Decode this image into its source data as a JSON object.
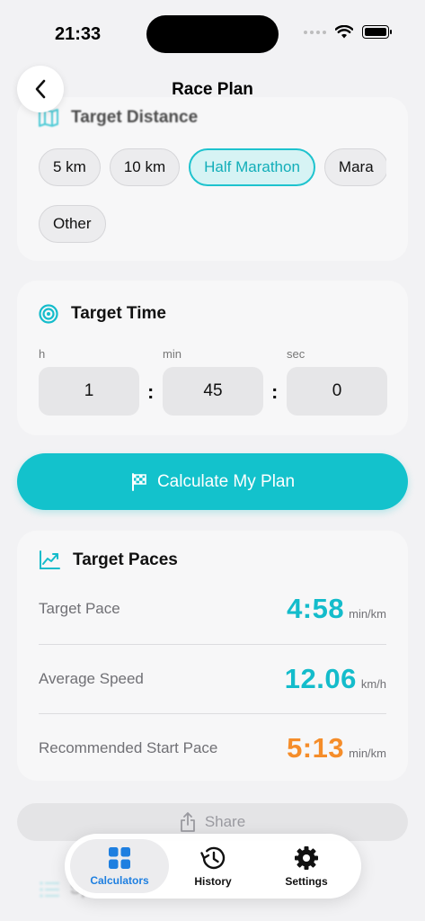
{
  "status_bar": {
    "time": "21:33"
  },
  "nav": {
    "title": "Race Plan"
  },
  "distance": {
    "title": "Target Distance",
    "chips": [
      {
        "label": "5 km",
        "selected": false
      },
      {
        "label": "10 km",
        "selected": false
      },
      {
        "label": "Half Marathon",
        "selected": true
      },
      {
        "label": "Mara",
        "selected": false
      }
    ],
    "other_label": "Other"
  },
  "target_time": {
    "title": "Target Time",
    "labels": {
      "hours": "h",
      "minutes": "min",
      "seconds": "sec"
    },
    "values": {
      "hours": "1",
      "minutes": "45",
      "seconds": "0"
    },
    "separator": ":"
  },
  "calculate_button": {
    "label": "Calculate My Plan"
  },
  "paces": {
    "title": "Target Paces",
    "rows": [
      {
        "label": "Target Pace",
        "value": "4:58",
        "unit": "min/km",
        "color": "#14bccb"
      },
      {
        "label": "Average Speed",
        "value": "12.06",
        "unit": "km/h",
        "color": "#14bccb"
      },
      {
        "label": "Recommended Start Pace",
        "value": "5:13",
        "unit": "min/km",
        "color": "#f58d2a"
      }
    ]
  },
  "share_button": {
    "label": "Share"
  },
  "faded_section": {
    "title": "Sp"
  },
  "tab_bar": {
    "tabs": [
      {
        "label": "Calculators",
        "active": true,
        "icon": "grid-icon"
      },
      {
        "label": "History",
        "active": false,
        "icon": "history-icon"
      },
      {
        "label": "Settings",
        "active": false,
        "icon": "gear-icon"
      }
    ]
  },
  "colors": {
    "accent": "#13c2cc",
    "tab_active": "#1e7fe0",
    "warning": "#f58d2a"
  }
}
